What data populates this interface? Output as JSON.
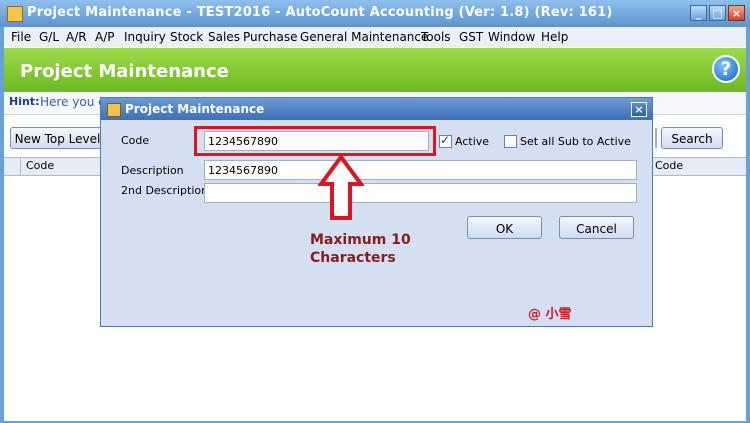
{
  "window": {
    "title": "Project Maintenance - TEST2016 - AutoCount Accounting (Ver: 1.8) (Rev: 161)",
    "controls": [
      "_",
      "□",
      "×"
    ]
  },
  "menu": [
    "File",
    "G/L",
    "A/R",
    "A/P",
    "Inquiry",
    "Stock",
    "Sales",
    "Purchase",
    "General Maintenance",
    "Tools",
    "GST",
    "Window",
    "Help"
  ],
  "header": {
    "title": "Project Maintenance",
    "help_glyph": "?"
  },
  "hint": {
    "label": "Hint:",
    "text": "Here you c"
  },
  "toolbar": {
    "new_top_level": "New Top Level",
    "search": "Search"
  },
  "grid": {
    "col_code": "Code",
    "col_right": "Code"
  },
  "dialog": {
    "title": "Project Maintenance",
    "close_glyph": "×",
    "code_label": "Code",
    "code_value": "1234567890",
    "active_label": "Active",
    "active_checked": true,
    "sub_active_label": "Set all Sub to Active",
    "sub_active_checked": false,
    "description_label": "Description",
    "description_value": "1234567890",
    "description2_label": "2nd Description",
    "description2_value": "",
    "ok_label": "OK",
    "cancel_label": "Cancel"
  },
  "annotation": {
    "line1": "Maximum 10",
    "line2": "Characters",
    "watermark": "@ 小雪"
  },
  "colors": {
    "header_green": "#7fc631",
    "highlight_red": "#e0141e",
    "annotation_text": "#8a1b1b"
  }
}
